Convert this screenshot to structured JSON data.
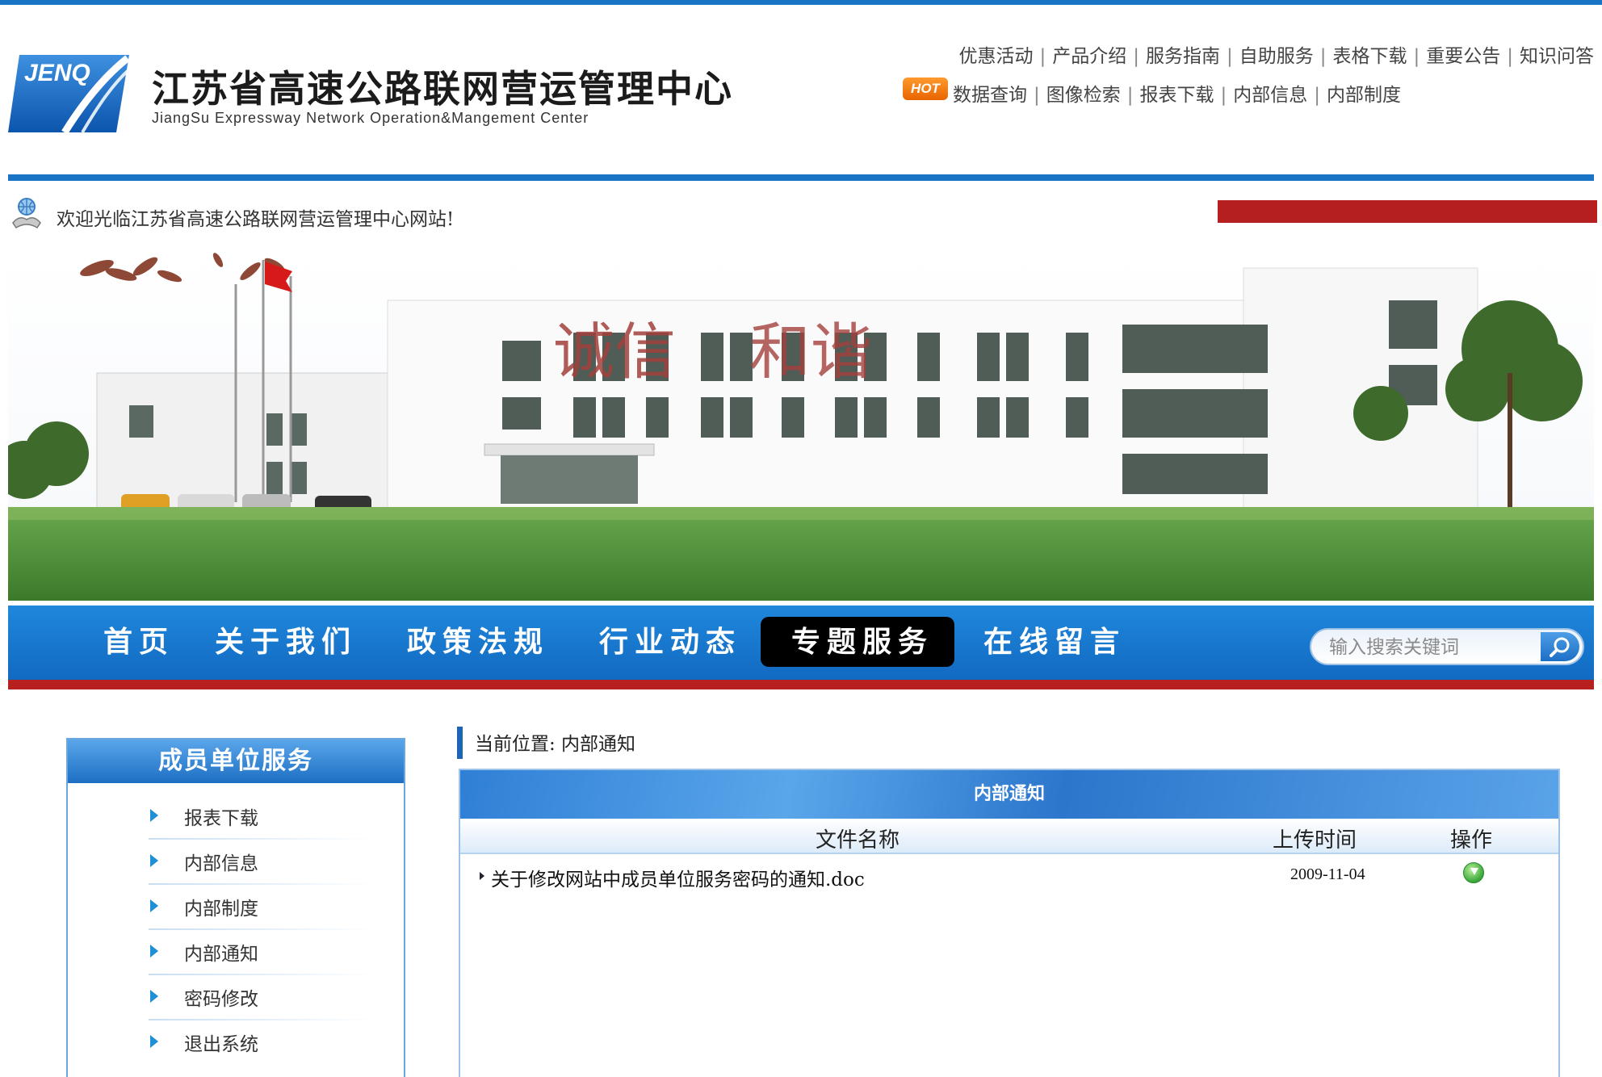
{
  "header": {
    "logo_text": "JENQ",
    "title": "江苏省高速公路联网营运管理中心",
    "subtitle": "JiangSu Expressway Network Operation&Mangement Center",
    "top_links_row1": [
      "优惠活动",
      "产品介绍",
      "服务指南",
      "自助服务",
      "表格下载",
      "重要公告",
      "知识问答"
    ],
    "hot_badge": "HOT",
    "top_links_row2": [
      "数据查询",
      "图像检索",
      "报表下载",
      "内部信息",
      "内部制度"
    ]
  },
  "welcome": {
    "text": "欢迎光临江苏省高速公路联网营运管理中心网站!"
  },
  "banner": {
    "slogan_left": "诚信",
    "slogan_right": "和谐"
  },
  "nav": {
    "items": [
      "首页",
      "关于我们",
      "政策法规",
      "行业动态",
      "专题服务",
      "在线留言"
    ],
    "active": "专题服务",
    "search_placeholder": "输入搜索关键词"
  },
  "sidebar": {
    "title": "成员单位服务",
    "items": [
      "报表下载",
      "内部信息",
      "内部制度",
      "内部通知",
      "密码修改",
      "退出系统"
    ]
  },
  "breadcrumb": {
    "text": "当前位置: 内部通知"
  },
  "panel": {
    "title": "内部通知",
    "columns": [
      "文件名称",
      "上传时间",
      "操作"
    ],
    "rows": [
      {
        "name": "关于修改网站中成员单位服务密码的通知.doc",
        "date": "2009-11-04"
      }
    ]
  },
  "colors": {
    "brand_blue": "#1a74c6",
    "accent_red": "#b81f1f",
    "nav_active": "#000000"
  },
  "icons": {
    "welcome": "handshake-globe-icon",
    "search": "magnifier-icon",
    "download": "download-icon"
  }
}
